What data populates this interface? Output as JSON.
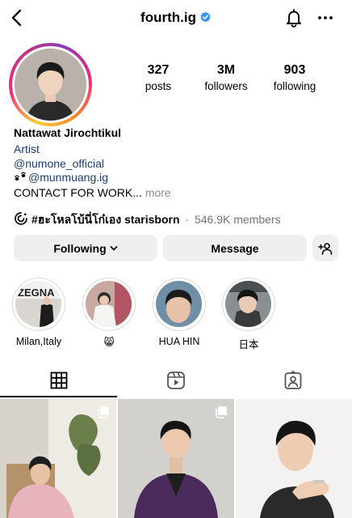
{
  "header": {
    "username": "fourth.ig",
    "icons": {
      "back": "chevron-left-icon",
      "verified": "verified-badge-icon",
      "notifications": "bell-icon",
      "more": "more-horizontal-icon"
    }
  },
  "profile": {
    "stats": [
      {
        "value": "327",
        "label": "posts"
      },
      {
        "value": "3M",
        "label": "followers"
      },
      {
        "value": "903",
        "label": "following"
      }
    ],
    "full_name": "Nattawat Jirochtikul",
    "category": "Artist",
    "links": [
      "@numone_official",
      "@munmuang.ig"
    ],
    "bio": "CONTACT FOR WORK...",
    "bio_more": "more"
  },
  "channel": {
    "name": "#ฮะโหลโบ้นี่โก๋เอง starisborn",
    "separator": "·",
    "members": "546.9K members"
  },
  "actions": {
    "following_label": "Following",
    "message_label": "Message",
    "add_user_icon": "add-user-icon"
  },
  "highlights": [
    {
      "label": "Milan,Italy"
    },
    {
      "label": "😸"
    },
    {
      "label": "HUA HIN"
    },
    {
      "label": "日本"
    }
  ],
  "tabs": [
    {
      "name": "posts-grid",
      "icon": "grid-icon",
      "active": true
    },
    {
      "name": "reels",
      "icon": "reels-icon",
      "active": false
    },
    {
      "name": "tagged",
      "icon": "tagged-icon",
      "active": false
    }
  ],
  "colors": {
    "link": "#1b3f75",
    "verified": "#3897f0",
    "button_bg": "#efefef",
    "muted": "#737373"
  }
}
